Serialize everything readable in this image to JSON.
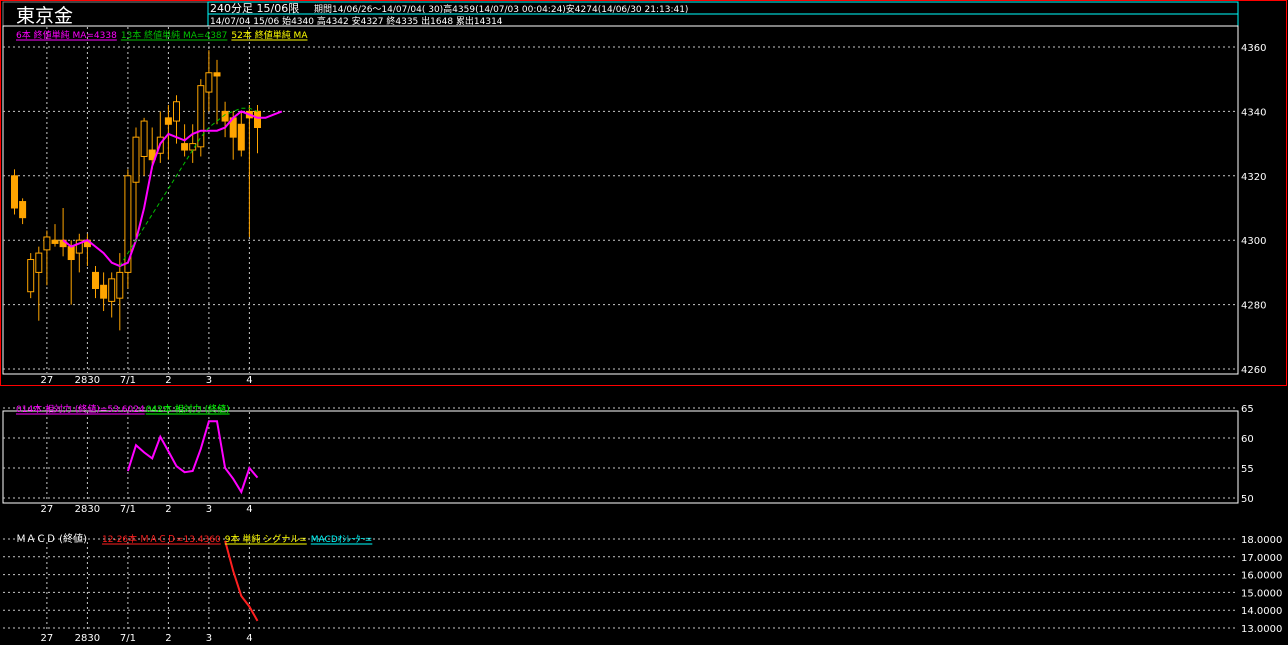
{
  "header": {
    "title": "東京金",
    "period_line": "240分足 15/06限",
    "range_info": "期間14/06/26～14/07/04( 30)高4359(14/07/03 00:04:24)安4274(14/06/30 21:13:41)",
    "last_bar_info": "14/07/04 15/06 始4340 高4342 安4327 終4335 出1648 累出14314"
  },
  "colors": {
    "bull_candle": "#ffa500",
    "wick": "#ffa500",
    "ma6": "#ff00ff",
    "ma13": "#00c000",
    "ma52": "#ffff00",
    "rsi14": "#ff00ff",
    "rsi42": "#00ff00",
    "macd": "#ff2020",
    "signal": "#ffff00",
    "osc": "#00ffff",
    "grid": "#c8c8c8",
    "panel_border": "#ffffff",
    "frame": "#ff0000"
  },
  "legends": {
    "price": [
      {
        "text": "6本 終値単純 MA=4338",
        "color_key": "ma6"
      },
      {
        "text": "13本 終値単純 MA=4387",
        "color_key": "ma13"
      },
      {
        "text": "52本 終値単純 MA",
        "color_key": "ma52"
      }
    ],
    "rsi": [
      {
        "text": "014本 相対力 (終値)=53.6024",
        "color_key": "rsi14"
      },
      {
        "text": "042本 相対力 (終値)",
        "color_key": "rsi42"
      }
    ],
    "macd_title": "ＭＡＣＤ (終値)",
    "macd": [
      {
        "text": "12-26本 ＭＡＣＤ=13.4360",
        "color_key": "macd"
      },
      {
        "text": "9本 単純 シグナル=",
        "color_key": "signal"
      },
      {
        "text": "MACDｵｼﾚｰﾀｰ=",
        "color_key": "osc"
      }
    ]
  },
  "x_labels": [
    {
      "label": "27",
      "bar": 4
    },
    {
      "label": "2830",
      "bar": 9
    },
    {
      "label": "7/1",
      "bar": 14
    },
    {
      "label": "2",
      "bar": 19
    },
    {
      "label": "3",
      "bar": 24
    },
    {
      "label": "4",
      "bar": 29
    }
  ],
  "chart_data": [
    {
      "type": "candlestick",
      "panel": "price",
      "ylim": [
        4260,
        4365
      ],
      "yticks": [
        4260,
        4280,
        4300,
        4320,
        4340,
        4360
      ],
      "candles": [
        {
          "o": 4320,
          "h": 4322,
          "l": 4308,
          "c": 4310
        },
        {
          "o": 4312,
          "h": 4313,
          "l": 4305,
          "c": 4307
        },
        {
          "o": 4284,
          "h": 4296,
          "l": 4282,
          "c": 4294
        },
        {
          "o": 4290,
          "h": 4298,
          "l": 4275,
          "c": 4296
        },
        {
          "o": 4297,
          "h": 4303,
          "l": 4286,
          "c": 4301
        },
        {
          "o": 4300,
          "h": 4305,
          "l": 4298,
          "c": 4299
        },
        {
          "o": 4300,
          "h": 4310,
          "l": 4295,
          "c": 4298
        },
        {
          "o": 4298,
          "h": 4300,
          "l": 4280,
          "c": 4294
        },
        {
          "o": 4296,
          "h": 4302,
          "l": 4290,
          "c": 4300
        },
        {
          "o": 4300,
          "h": 4302,
          "l": 4292,
          "c": 4298
        },
        {
          "o": 4290,
          "h": 4292,
          "l": 4282,
          "c": 4285
        },
        {
          "o": 4286,
          "h": 4290,
          "l": 4278,
          "c": 4282
        },
        {
          "o": 4281,
          "h": 4290,
          "l": 4276,
          "c": 4288
        },
        {
          "o": 4282,
          "h": 4296,
          "l": 4272,
          "c": 4290
        },
        {
          "o": 4290,
          "h": 4322,
          "l": 4285,
          "c": 4320
        },
        {
          "o": 4318,
          "h": 4335,
          "l": 4300,
          "c": 4332
        },
        {
          "o": 4326,
          "h": 4338,
          "l": 4320,
          "c": 4337
        },
        {
          "o": 4328,
          "h": 4335,
          "l": 4322,
          "c": 4325
        },
        {
          "o": 4327,
          "h": 4340,
          "l": 4324,
          "c": 4332
        },
        {
          "o": 4338,
          "h": 4342,
          "l": 4325,
          "c": 4336
        },
        {
          "o": 4337,
          "h": 4345,
          "l": 4330,
          "c": 4343
        },
        {
          "o": 4330,
          "h": 4336,
          "l": 4326,
          "c": 4328
        },
        {
          "o": 4328,
          "h": 4336,
          "l": 4324,
          "c": 4330
        },
        {
          "o": 4329,
          "h": 4350,
          "l": 4326,
          "c": 4348
        },
        {
          "o": 4346,
          "h": 4359,
          "l": 4340,
          "c": 4352
        },
        {
          "o": 4352,
          "h": 4356,
          "l": 4336,
          "c": 4351
        },
        {
          "o": 4340,
          "h": 4343,
          "l": 4332,
          "c": 4337
        },
        {
          "o": 4338,
          "h": 4340,
          "l": 4325,
          "c": 4332
        },
        {
          "o": 4336,
          "h": 4340,
          "l": 4326,
          "c": 4328
        },
        {
          "o": 4340,
          "h": 4342,
          "l": 4301,
          "c": 4338
        },
        {
          "o": 4340,
          "h": 4342,
          "l": 4327,
          "c": 4335
        }
      ],
      "series": [
        {
          "name": "6本 終値単純 MA",
          "color_key": "ma6",
          "dash": false,
          "start": 6,
          "values": [
            4300,
            4298,
            4299,
            4300,
            4298,
            4296,
            4293,
            4292,
            4293,
            4300,
            4310,
            4323,
            4330,
            4333,
            4332,
            4331,
            4333,
            4334,
            4334,
            4334,
            4335,
            4338,
            4340,
            4339,
            4338,
            4338,
            4339,
            4340
          ]
        },
        {
          "name": "13本 終値単純 MA",
          "color_key": "ma13",
          "dash": true,
          "start": 13,
          "values": [
            4292,
            4296,
            4300,
            4304,
            4308,
            4312,
            4316,
            4320,
            4324,
            4328,
            4332,
            4335,
            4337,
            4339,
            4340,
            4341,
            4341,
            4340
          ]
        }
      ]
    },
    {
      "type": "line",
      "panel": "rsi",
      "ylim": [
        50,
        65
      ],
      "yticks": [
        50,
        55,
        60,
        65
      ],
      "series": [
        {
          "name": "014本 相対力 (終値)",
          "color_key": "rsi14",
          "start": 14,
          "values": [
            54.5,
            58.8,
            57.6,
            56.6,
            60.2,
            57.8,
            55.3,
            54.3,
            54.5,
            58.2,
            62.8,
            62.8,
            55.0,
            53.2,
            51.0,
            55.0,
            53.4
          ]
        }
      ]
    },
    {
      "type": "line",
      "panel": "macd",
      "ylim": [
        12.8,
        18.4
      ],
      "yticks": [
        13.0,
        14.0,
        15.0,
        16.0,
        17.0,
        18.0
      ],
      "ytick_labels": [
        "13.0000",
        "14.0000",
        "15.0000",
        "16.0000",
        "17.0000",
        "18.0000"
      ],
      "series": [
        {
          "name": "12-26本 ＭＡＣＤ",
          "color_key": "macd",
          "start": 26,
          "values": [
            17.9,
            16.2,
            14.8,
            14.2,
            13.4
          ]
        }
      ]
    }
  ]
}
